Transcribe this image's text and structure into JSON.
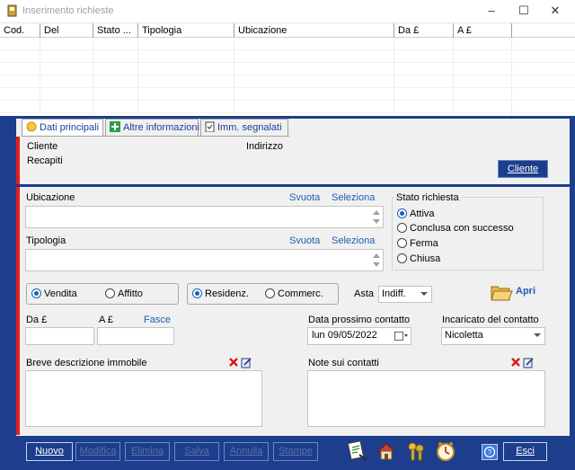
{
  "window": {
    "title": "Inserimento richieste",
    "minimize": "–",
    "maximize": "☐",
    "close": "✕"
  },
  "grid": {
    "columns": [
      "Cod.",
      "Del",
      "Stato ...",
      "Tipologia",
      "Ubicazione",
      "Da £",
      "A £"
    ]
  },
  "tabs": [
    {
      "label": "Dati principali",
      "icon": "sun-icon"
    },
    {
      "label": "Altre informazioni",
      "icon": "plus-icon"
    },
    {
      "label": "Imm. segnalati",
      "icon": "clipboard-icon"
    }
  ],
  "main": {
    "cliente_label": "Cliente",
    "indirizzo_label": "Indirizzo",
    "recapiti_label": "Recapiti",
    "cliente_button": "Cliente",
    "ubicazione_label": "Ubicazione",
    "svuota1": "Svuota",
    "seleziona1": "Seleziona",
    "tipologia_label": "Tipologia",
    "svuota2": "Svuota",
    "seleziona2": "Seleziona",
    "stato_title": "Stato richiesta",
    "stato_options": [
      "Attiva",
      "Conclusa con successo",
      "Ferma",
      "Chiusa"
    ],
    "stato_selected": "Attiva",
    "contratto": [
      "Vendita",
      "Affitto"
    ],
    "contratto_selected": "Vendita",
    "destinazione": [
      "Residenz.",
      "Commerc."
    ],
    "destinazione_selected": "Residenz.",
    "asta_label": "Asta",
    "asta_value": "Indiff.",
    "apri_label": "Apri",
    "da_label": "Da £",
    "a_label": "A £",
    "fasce_label": "Fasce",
    "data_label": "Data prossimo contatto",
    "data_value": "lun  09/05/2022",
    "incaricato_label": "Incaricato del contatto",
    "incaricato_value": "Nicoletta",
    "descrizione_label": "Breve descrizione immobile",
    "note_label": "Note sui contatti"
  },
  "toolbar": {
    "nuovo": "Nuovo",
    "modifica": "Modifica",
    "elimina": "Elimina",
    "salva": "Salva",
    "annulla": "Annulla",
    "stampe": "Stampe",
    "esci": "Esci",
    "icons": [
      "document-icon",
      "house-icon",
      "keys-icon",
      "clock-icon",
      "help-icon"
    ]
  },
  "colors": {
    "panel_blue": "#1c3e8c",
    "accent_red": "#e02020",
    "link_blue": "#1a5fb4"
  }
}
